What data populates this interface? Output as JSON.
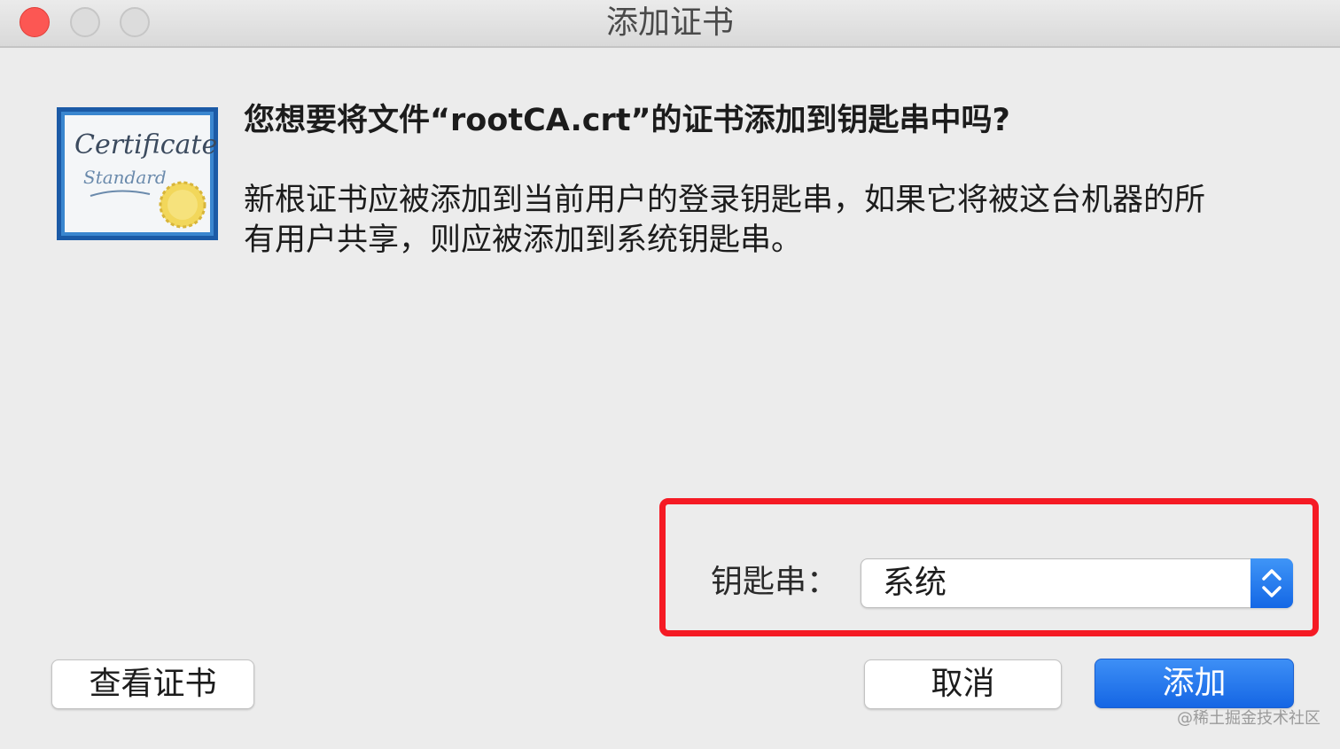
{
  "window": {
    "title": "添加证书",
    "buttons": [
      "close",
      "minimize",
      "zoom"
    ]
  },
  "icon": {
    "name": "certificate-icon",
    "line1": "Certificate",
    "line2": "Standard"
  },
  "dialog": {
    "heading": "您想要将文件“rootCA.crt”的证书添加到钥匙串中吗?",
    "body_line1": "新根证书应被添加到当前用户的登录钥匙串，如果它将被这台机器的所",
    "body_line2": "有用户共享，则应被添加到系统钥匙串。"
  },
  "keychain": {
    "label": "钥匙串：",
    "selected": "系统"
  },
  "buttons": {
    "view_cert": "查看证书",
    "cancel": "取消",
    "add": "添加"
  },
  "watermark": "@稀土掘金技术社区",
  "colors": {
    "close": "#fc5753",
    "accent": "#1a6fe8",
    "highlight": "#f51a24"
  }
}
